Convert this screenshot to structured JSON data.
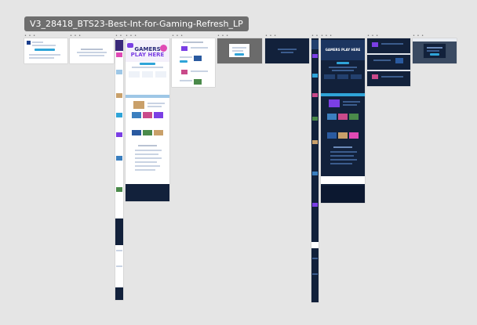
{
  "canvas": {
    "file_title": "V3_28418_BTS23-Best-Int-for-Gaming-Refresh_LP",
    "background_color": "#e5e5e5"
  },
  "frames": {
    "label_dots": "• • •"
  },
  "hero": {
    "light_line1": "GAMERS",
    "light_line2": "PLAY HERE",
    "dark_title": "GAMERS PLAY HERE"
  },
  "colors": {
    "accent_blue": "#2fa4d8",
    "dark_navy": "#12213b",
    "hero_purple": "#7b3fe4",
    "hero_pink": "#e04ab5"
  }
}
